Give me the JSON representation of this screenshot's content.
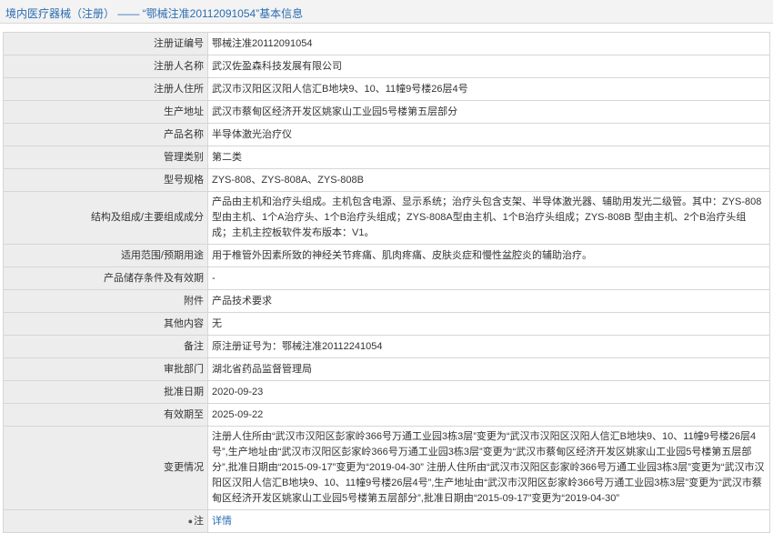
{
  "header": {
    "title": "境内医疗器械（注册） —— “鄂械注准20112091054”基本信息"
  },
  "rows": [
    {
      "label": "注册证编号",
      "value": "鄂械注准20112091054"
    },
    {
      "label": "注册人名称",
      "value": "武汉佐盈森科技发展有限公司"
    },
    {
      "label": "注册人住所",
      "value": "武汉市汉阳区汉阳人信汇B地块9、10、11幢9号楼26层4号"
    },
    {
      "label": "生产地址",
      "value": "武汉市蔡甸区经济开发区姚家山工业园5号楼第五层部分"
    },
    {
      "label": "产品名称",
      "value": "半导体激光治疗仪"
    },
    {
      "label": "管理类别",
      "value": "第二类"
    },
    {
      "label": "型号规格",
      "value": "ZYS-808、ZYS-808A、ZYS-808B"
    },
    {
      "label": "结构及组成/主要组成成分",
      "value": "产品由主机和治疗头组成。主机包含电源、显示系统；治疗头包含支架、半导体激光器、辅助用发光二级管。其中：ZYS-808 型由主机、1个A治疗头、1个B治疗头组成；ZYS-808A型由主机、1个B治疗头组成；ZYS-808B 型由主机、2个B治疗头组成；主机主控板软件发布版本：V1。"
    },
    {
      "label": "适用范围/预期用途",
      "value": "用于椎管外因素所致的神经关节疼痛、肌肉疼痛、皮肤炎症和慢性盆腔炎的辅助治疗。"
    },
    {
      "label": "产品储存条件及有效期",
      "value": "-"
    },
    {
      "label": "附件",
      "value": "产品技术要求"
    },
    {
      "label": "其他内容",
      "value": "无"
    },
    {
      "label": "备注",
      "value": "原注册证号为：鄂械注准20112241054"
    },
    {
      "label": "审批部门",
      "value": "湖北省药品监督管理局"
    },
    {
      "label": "批准日期",
      "value": "2020-09-23"
    },
    {
      "label": "有效期至",
      "value": "2025-09-22"
    },
    {
      "label": "变更情况",
      "value": "注册人住所由“武汉市汉阳区彭家岭366号万通工业园3栋3层”变更为“武汉市汉阳区汉阳人信汇B地块9、10、11幢9号楼26层4号”,生产地址由“武汉市汉阳区彭家岭366号万通工业园3栋3层”变更为“武汉市蔡甸区经济开发区姚家山工业园5号楼第五层部分”,批准日期由“2015-09-17”变更为“2019-04-30” 注册人住所由“武汉市汉阳区彭家岭366号万通工业园3栋3层”变更为“武汉市汉阳区汉阳人信汇B地块9、10、11幢9号楼26层4号”,生产地址由“武汉市汉阳区彭家岭366号万通工业园3栋3层”变更为“武汉市蔡甸区经济开发区姚家山工业园5号楼第五层部分”,批准日期由“2015-09-17”变更为“2019-04-30”"
    }
  ],
  "note_row": {
    "icon": "pin-icon",
    "label": "注",
    "link": "详情"
  },
  "colors": {
    "title": "#2c6cb0",
    "label_bg": "#ededed",
    "border": "#d6d6d6",
    "link": "#2c6cb0"
  }
}
